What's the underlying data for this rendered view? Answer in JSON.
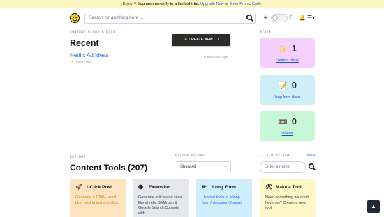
{
  "banner": {
    "enjoy": "Enjoy",
    "heart_icon": "heart-icon",
    "trial_text": "You are currently in a limited trial.",
    "upgrade_link": "Upgrade Now",
    "or_text": "or",
    "promo_link": "Enter Promo Code"
  },
  "header": {
    "search_placeholder": "Search for anything here ...",
    "logo_icon": "smiley-logo-icon"
  },
  "recent": {
    "section_label": "CONTENT PLANS & DOCS",
    "title": "Recent",
    "create_button": "✨ CREATE NEW ... ›",
    "items": [
      {
        "title": "Netflix Ad Ideas",
        "type": "content plan",
        "time": "9 minutes ago"
      }
    ]
  },
  "stats": {
    "label": "STATS",
    "cards": [
      {
        "emoji": "✨",
        "value": "1",
        "label": "content plans",
        "color": "#f5d0fe"
      },
      {
        "emoji": "📝",
        "value": "0",
        "label": "long form docs",
        "color": "#cfeff8"
      },
      {
        "emoji": "📼",
        "value": "0",
        "label": "videos",
        "color": "#c7f7d4"
      }
    ]
  },
  "explore": {
    "label": "EXPLORE",
    "title": "Content Tools (207)",
    "filter_tag_label": "FILTER BY TAG",
    "filter_tag_value": "Show All",
    "filter_name_label": "FILTER BY NAME",
    "reset_label": "Reset",
    "name_placeholder": "Enter a name"
  },
  "tools": [
    {
      "icon": "🚀",
      "name": "1-Click Post",
      "desc": "Generate a 1000+ word blog post in just one click",
      "color": "#fde4c0"
    },
    {
      "icon": "◉",
      "name": "Extension",
      "desc": "Generate articles on sites like ahrefs, SEMrush & Google Search Console with",
      "color": "#e5e7eb"
    },
    {
      "icon": "✏",
      "name": "Long Form",
      "desc": "Use our tools in a long form / document format",
      "color": "#cfeefb"
    },
    {
      "icon": "🛠",
      "name": "Make a Tool",
      "desc": "Need something we don't have yet? Create a new tool.",
      "color": "#fef7c7"
    }
  ]
}
